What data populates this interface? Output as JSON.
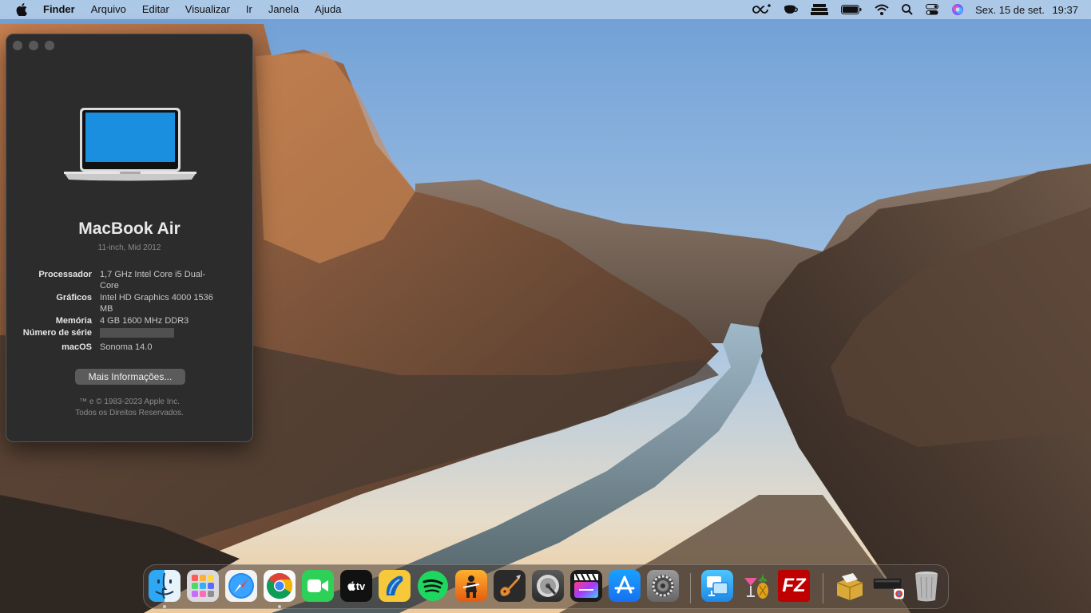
{
  "menubar": {
    "app_name": "Finder",
    "menus": [
      "Arquivo",
      "Editar",
      "Visualizar",
      "Ir",
      "Janela",
      "Ajuda"
    ],
    "status_icons": [
      "infinity-plus-icon",
      "coffee-cup-icon",
      "stack-icon",
      "battery-icon",
      "wifi-icon",
      "search-icon",
      "control-center-icon",
      "siri-icon"
    ],
    "date": "Sex. 15 de set.",
    "time": "19:37"
  },
  "about": {
    "model": "MacBook Air",
    "submodel": "11-inch, Mid 2012",
    "specs": {
      "processor_label": "Processador",
      "processor_value": "1,7 GHz Intel Core i5 Dual-Core",
      "graphics_label": "Gráficos",
      "graphics_value": "Intel HD Graphics 4000 1536 MB",
      "memory_label": "Memória",
      "memory_value": "4 GB 1600 MHz DDR3",
      "serial_label": "Número de série",
      "macos_label": "macOS",
      "macos_value": "Sonoma 14.0"
    },
    "more_button": "Mais Informações...",
    "copyright_line1": "™ e © 1983-2023 Apple Inc.",
    "copyright_line2": "Todos os Direitos Reservados."
  },
  "dock": {
    "apps": [
      "finder-icon",
      "launchpad-icon",
      "safari-icon",
      "chrome-icon",
      "facetime-icon",
      "apple-tv-icon",
      "sketchbook-icon",
      "spotify-icon",
      "mainstage-icon",
      "garageband-icon",
      "disk-utility-icon",
      "final-cut-pro-icon",
      "app-store-icon",
      "system-settings-icon",
      "screen-sharing-icon",
      "cocktail-icon",
      "filezilla-icon",
      "archive-icon",
      "chrome-apps-folder-icon",
      "trash-icon"
    ],
    "tv_label": "tv",
    "filezilla_label": "FZ"
  }
}
